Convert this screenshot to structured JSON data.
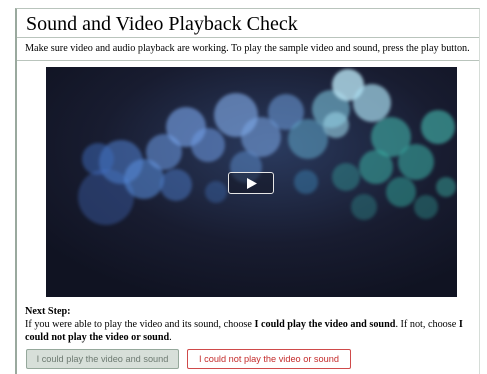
{
  "page": {
    "title": "Sound and Video Playback Check",
    "instructions": "Make sure video and audio playback are working. To play the sample video and sound, press the play button."
  },
  "video": {
    "play_icon": "play-icon",
    "theme_colors": [
      "#15182a",
      "#5a8fd6",
      "#3fb3a8",
      "#8fd4e6"
    ]
  },
  "next_step": {
    "heading": "Next Step:",
    "text_part1": "If you were able to play the video and its sound, choose ",
    "text_bold1": "I could play the video and sound",
    "text_part2": ". If not, choose ",
    "text_bold2": "I could not play the video or sound",
    "text_part3": "."
  },
  "buttons": {
    "could_play_label": "I could play the video and sound",
    "could_not_play_label": "I could not play the video or sound"
  }
}
